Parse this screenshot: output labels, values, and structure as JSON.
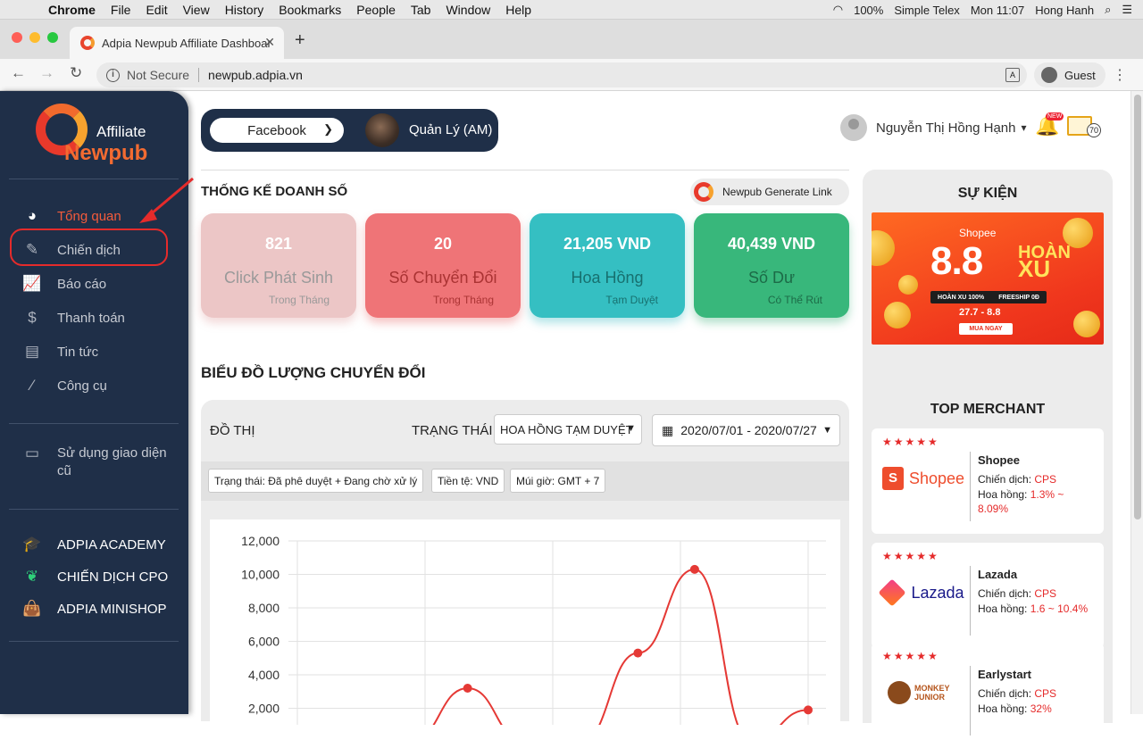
{
  "macbar": {
    "app": "Chrome",
    "menus": [
      "File",
      "Edit",
      "View",
      "History",
      "Bookmarks",
      "People",
      "Tab",
      "Window",
      "Help"
    ],
    "battery": "100%",
    "input_method": "Simple Telex",
    "clock": "Mon 11:07",
    "user": "Hong Hanh"
  },
  "browser": {
    "tab_title": "Adpia Newpub Affiliate Dashboard",
    "security": "Not Secure",
    "url": "newpub.adpia.vn",
    "profile": "Guest"
  },
  "sidebar": {
    "logo_top": "Affiliate",
    "logo_bottom": "Newpub",
    "items": [
      {
        "label": "Tổng quan",
        "icon": "pie-chart-icon"
      },
      {
        "label": "Chiến dịch",
        "icon": "edit-icon"
      },
      {
        "label": "Báo cáo",
        "icon": "line-chart-icon"
      },
      {
        "label": "Thanh toán",
        "icon": "dollar-icon"
      },
      {
        "label": "Tin tức",
        "icon": "newspaper-icon"
      },
      {
        "label": "Công cụ",
        "icon": "magic-wand-icon"
      }
    ],
    "legacy_label": "Sử dụng giao diện cũ",
    "bottom_items": [
      {
        "label": "ADPIA ACADEMY",
        "icon": "graduation-cap-icon",
        "color": "#f4a224"
      },
      {
        "label": "CHIẾN DỊCH CPO",
        "icon": "leaf-icon",
        "color": "#2fd07a"
      },
      {
        "label": "ADPIA MINISHOP",
        "icon": "shopping-bag-icon",
        "color": "#e8396c"
      }
    ]
  },
  "header": {
    "platform": "Facebook",
    "manager": "Quản Lý (AM)",
    "user_name": "Nguyễn Thị Hồng Hạnh",
    "bell_badge": "NEW",
    "mail_count": "70"
  },
  "stats": {
    "title": "THỐNG KẾ DOANH SỐ",
    "generate_link": "Newpub Generate Link",
    "cards": [
      {
        "value": "821",
        "label": "Click Phát Sinh",
        "sub": "Trong Tháng",
        "bg": "#ecc6c6",
        "label_color": "#999"
      },
      {
        "value": "20",
        "label": "Số Chuyển Đổi",
        "sub": "Trong Tháng",
        "bg": "#ef7477",
        "label_color": "#a33"
      },
      {
        "value": "21,205 VND",
        "label": "Hoa Hồng",
        "sub": "Tạm Duyệt",
        "bg": "#35bfc2",
        "label_color": "#17706f"
      },
      {
        "value": "40,439 VND",
        "label": "Số Dư",
        "sub": "Có Thể Rút",
        "bg": "#38b77b",
        "label_color": "#1c6b47"
      }
    ]
  },
  "chart_section": {
    "title": "BIỂU ĐỒ LƯỢNG CHUYỂN ĐỔI",
    "graph_label": "ĐỒ THỊ",
    "status_label": "TRẠNG THÁI",
    "status_value": "HOA HỒNG TẠM DUYỆT",
    "date_range": "2020/07/01 - 2020/07/27",
    "chips": [
      "Trạng thái: Đã phê duyệt + Đang chờ xử lý",
      "Tiền tệ: VND",
      "Múi giờ: GMT + 7"
    ]
  },
  "chart_data": {
    "type": "line",
    "title": "",
    "xlabel": "",
    "ylabel": "",
    "y_ticks": [
      "12,000",
      "10,000",
      "8,000",
      "6,000",
      "4,000",
      "2,000"
    ],
    "ylim": [
      0,
      12000
    ],
    "grid": true,
    "color": "#e53935",
    "points": [
      [
        1,
        0
      ],
      [
        2,
        0
      ],
      [
        3,
        0
      ],
      [
        4,
        3200
      ],
      [
        5,
        0
      ],
      [
        6,
        0
      ],
      [
        7,
        5300
      ],
      [
        8,
        10300
      ],
      [
        9,
        0
      ],
      [
        10,
        1900
      ]
    ]
  },
  "right_panel": {
    "events_title": "SỰ KIỆN",
    "banner": {
      "brand": "Shopee",
      "headline": "8.8",
      "hoan": "HOÀN",
      "xu": "XU",
      "tags": [
        "HOÀN XU 100%",
        "FREESHIP 0Đ"
      ],
      "dates": "27.7 - 8.8",
      "cta": "MUA NGAY"
    },
    "top_merchant_title": "TOP MERCHANT",
    "merchants": [
      {
        "name": "Shopee",
        "logo": "Shopee",
        "stars": "★★★★★",
        "campaign_label": "Chiến dịch:",
        "campaign": "CPS",
        "commission_label": "Hoa hồng:",
        "commission": "1.3% ~ 8.09%",
        "color": "#ee4d2d"
      },
      {
        "name": "Lazada",
        "logo": "Lazada",
        "stars": "★★★★★",
        "campaign_label": "Chiến dịch:",
        "campaign": "CPS",
        "commission_label": "Hoa hồng:",
        "commission": "1.6 ~ 10.4%",
        "color": "#1a1a8a"
      },
      {
        "name": "Earlystart",
        "logo": "MONKEY JUNIOR",
        "stars": "★★★★★",
        "campaign_label": "Chiến dịch:",
        "campaign": "CPS",
        "commission_label": "Hoa hồng:",
        "commission": "32%",
        "color": "#b5551c"
      }
    ]
  }
}
